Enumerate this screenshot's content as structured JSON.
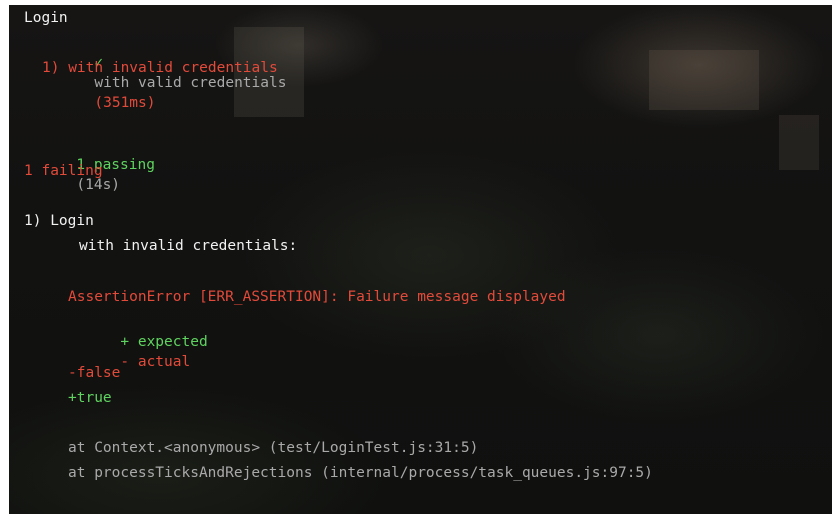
{
  "terminal": {
    "suite_title": "Login",
    "pass_mark": "✓",
    "pass_test": "with valid credentials",
    "pass_duration": "(351ms)",
    "fail_test": "1) with invalid credentials",
    "summary_passing_count": "1 passing",
    "summary_passing_time": "(14s)",
    "summary_failing": "1 failing",
    "failure_heading": "1) Login",
    "failure_subheading": "with invalid credentials:",
    "error_message": "AssertionError [ERR_ASSERTION]: Failure message displayed",
    "diff_legend_plus": "+ expected",
    "diff_legend_minus": "- actual",
    "diff_minus_line": "-false",
    "diff_plus_line": "+true",
    "stack_line_1": "at Context.<anonymous> (test/LoginTest.js:31:5)",
    "stack_line_2": "at processTicksAndRejections (internal/process/task_queues.js:97:5)"
  },
  "colors": {
    "pass": "#5fd35f",
    "fail": "#e24a3a",
    "text": "#f2f2f2",
    "muted": "#a9a9a9"
  }
}
